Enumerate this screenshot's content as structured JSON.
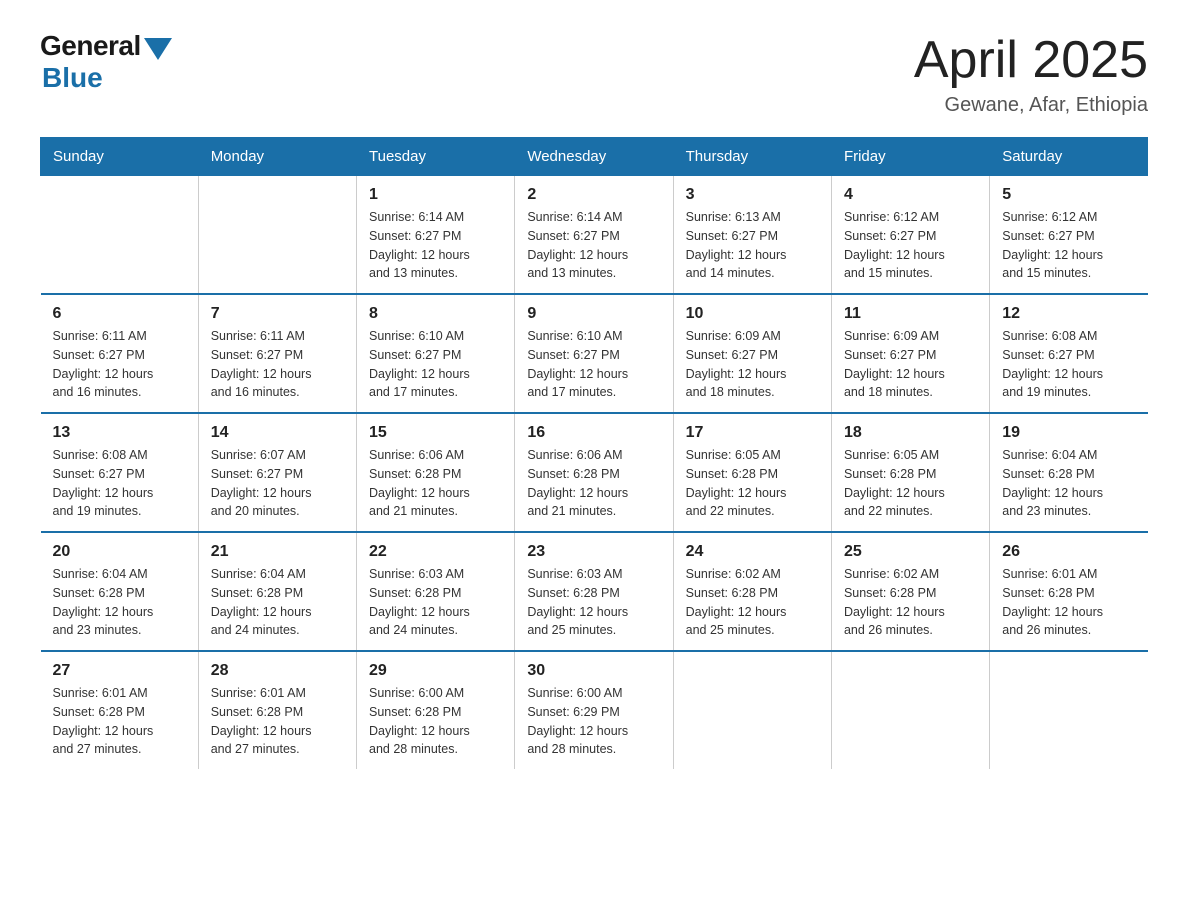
{
  "logo": {
    "general": "General",
    "blue": "Blue"
  },
  "title": "April 2025",
  "location": "Gewane, Afar, Ethiopia",
  "days_of_week": [
    "Sunday",
    "Monday",
    "Tuesday",
    "Wednesday",
    "Thursday",
    "Friday",
    "Saturday"
  ],
  "weeks": [
    [
      {
        "day": "",
        "info": ""
      },
      {
        "day": "",
        "info": ""
      },
      {
        "day": "1",
        "info": "Sunrise: 6:14 AM\nSunset: 6:27 PM\nDaylight: 12 hours\nand 13 minutes."
      },
      {
        "day": "2",
        "info": "Sunrise: 6:14 AM\nSunset: 6:27 PM\nDaylight: 12 hours\nand 13 minutes."
      },
      {
        "day": "3",
        "info": "Sunrise: 6:13 AM\nSunset: 6:27 PM\nDaylight: 12 hours\nand 14 minutes."
      },
      {
        "day": "4",
        "info": "Sunrise: 6:12 AM\nSunset: 6:27 PM\nDaylight: 12 hours\nand 15 minutes."
      },
      {
        "day": "5",
        "info": "Sunrise: 6:12 AM\nSunset: 6:27 PM\nDaylight: 12 hours\nand 15 minutes."
      }
    ],
    [
      {
        "day": "6",
        "info": "Sunrise: 6:11 AM\nSunset: 6:27 PM\nDaylight: 12 hours\nand 16 minutes."
      },
      {
        "day": "7",
        "info": "Sunrise: 6:11 AM\nSunset: 6:27 PM\nDaylight: 12 hours\nand 16 minutes."
      },
      {
        "day": "8",
        "info": "Sunrise: 6:10 AM\nSunset: 6:27 PM\nDaylight: 12 hours\nand 17 minutes."
      },
      {
        "day": "9",
        "info": "Sunrise: 6:10 AM\nSunset: 6:27 PM\nDaylight: 12 hours\nand 17 minutes."
      },
      {
        "day": "10",
        "info": "Sunrise: 6:09 AM\nSunset: 6:27 PM\nDaylight: 12 hours\nand 18 minutes."
      },
      {
        "day": "11",
        "info": "Sunrise: 6:09 AM\nSunset: 6:27 PM\nDaylight: 12 hours\nand 18 minutes."
      },
      {
        "day": "12",
        "info": "Sunrise: 6:08 AM\nSunset: 6:27 PM\nDaylight: 12 hours\nand 19 minutes."
      }
    ],
    [
      {
        "day": "13",
        "info": "Sunrise: 6:08 AM\nSunset: 6:27 PM\nDaylight: 12 hours\nand 19 minutes."
      },
      {
        "day": "14",
        "info": "Sunrise: 6:07 AM\nSunset: 6:27 PM\nDaylight: 12 hours\nand 20 minutes."
      },
      {
        "day": "15",
        "info": "Sunrise: 6:06 AM\nSunset: 6:28 PM\nDaylight: 12 hours\nand 21 minutes."
      },
      {
        "day": "16",
        "info": "Sunrise: 6:06 AM\nSunset: 6:28 PM\nDaylight: 12 hours\nand 21 minutes."
      },
      {
        "day": "17",
        "info": "Sunrise: 6:05 AM\nSunset: 6:28 PM\nDaylight: 12 hours\nand 22 minutes."
      },
      {
        "day": "18",
        "info": "Sunrise: 6:05 AM\nSunset: 6:28 PM\nDaylight: 12 hours\nand 22 minutes."
      },
      {
        "day": "19",
        "info": "Sunrise: 6:04 AM\nSunset: 6:28 PM\nDaylight: 12 hours\nand 23 minutes."
      }
    ],
    [
      {
        "day": "20",
        "info": "Sunrise: 6:04 AM\nSunset: 6:28 PM\nDaylight: 12 hours\nand 23 minutes."
      },
      {
        "day": "21",
        "info": "Sunrise: 6:04 AM\nSunset: 6:28 PM\nDaylight: 12 hours\nand 24 minutes."
      },
      {
        "day": "22",
        "info": "Sunrise: 6:03 AM\nSunset: 6:28 PM\nDaylight: 12 hours\nand 24 minutes."
      },
      {
        "day": "23",
        "info": "Sunrise: 6:03 AM\nSunset: 6:28 PM\nDaylight: 12 hours\nand 25 minutes."
      },
      {
        "day": "24",
        "info": "Sunrise: 6:02 AM\nSunset: 6:28 PM\nDaylight: 12 hours\nand 25 minutes."
      },
      {
        "day": "25",
        "info": "Sunrise: 6:02 AM\nSunset: 6:28 PM\nDaylight: 12 hours\nand 26 minutes."
      },
      {
        "day": "26",
        "info": "Sunrise: 6:01 AM\nSunset: 6:28 PM\nDaylight: 12 hours\nand 26 minutes."
      }
    ],
    [
      {
        "day": "27",
        "info": "Sunrise: 6:01 AM\nSunset: 6:28 PM\nDaylight: 12 hours\nand 27 minutes."
      },
      {
        "day": "28",
        "info": "Sunrise: 6:01 AM\nSunset: 6:28 PM\nDaylight: 12 hours\nand 27 minutes."
      },
      {
        "day": "29",
        "info": "Sunrise: 6:00 AM\nSunset: 6:28 PM\nDaylight: 12 hours\nand 28 minutes."
      },
      {
        "day": "30",
        "info": "Sunrise: 6:00 AM\nSunset: 6:29 PM\nDaylight: 12 hours\nand 28 minutes."
      },
      {
        "day": "",
        "info": ""
      },
      {
        "day": "",
        "info": ""
      },
      {
        "day": "",
        "info": ""
      }
    ]
  ]
}
